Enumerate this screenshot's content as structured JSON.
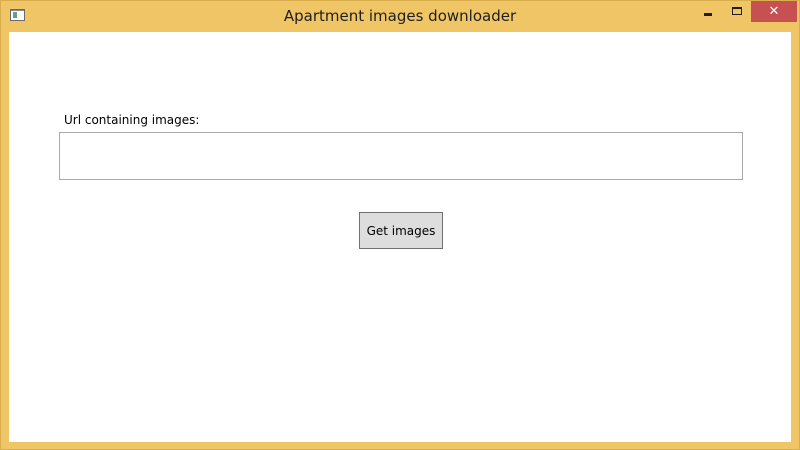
{
  "window": {
    "title": "Apartment images downloader",
    "icon": "application-window-icon",
    "controls": {
      "minimize_icon": "minimize-icon",
      "maximize_icon": "maximize-icon",
      "close_icon": "close-icon",
      "close_glyph": "✕"
    },
    "colors": {
      "frame": "#EFC566",
      "close_button": "#C75050",
      "client": "#FFFFFF"
    }
  },
  "form": {
    "url_label": "Url containing images:",
    "url_value": "",
    "get_images_label": "Get images"
  }
}
